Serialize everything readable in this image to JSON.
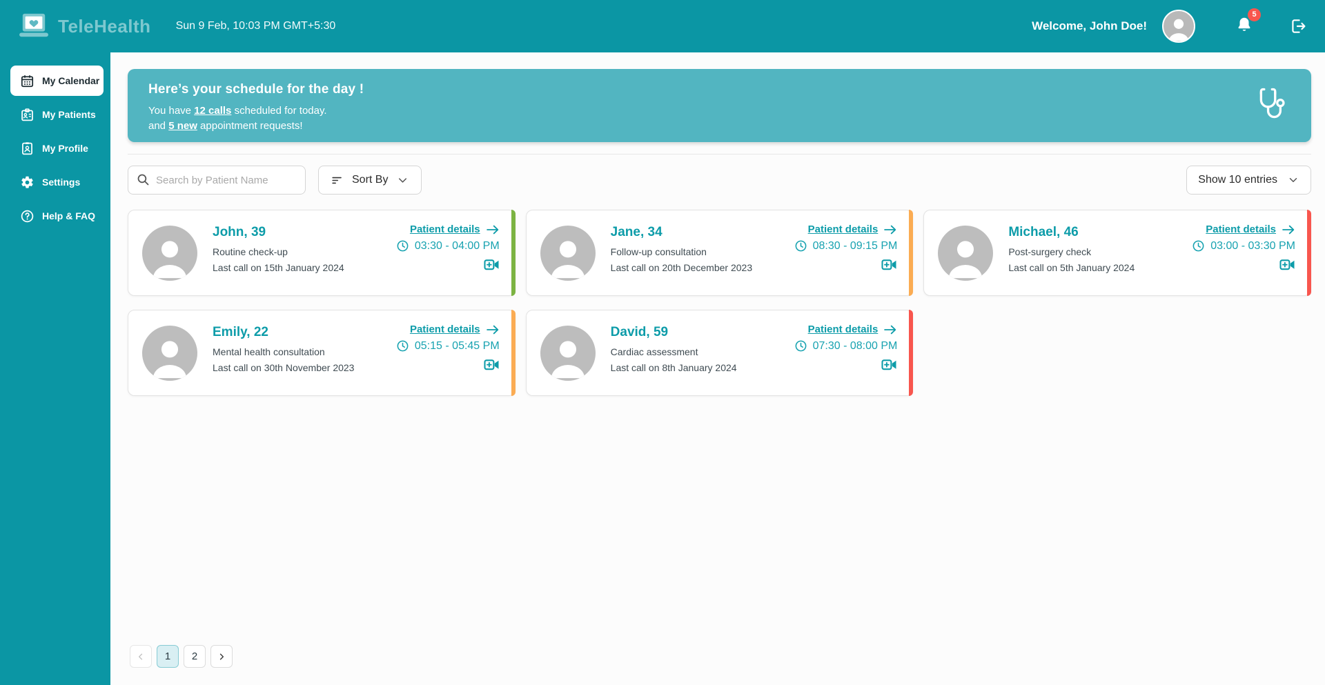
{
  "header": {
    "brand": "TeleHealth",
    "datetime": "Sun 9 Feb, 10:03 PM GMT+5:30",
    "welcome": "Welcome, John Doe!",
    "notification_count": "5"
  },
  "sidebar": {
    "items": [
      {
        "label": "My Calendar",
        "icon": "calendar-icon",
        "active": true
      },
      {
        "label": "My Patients",
        "icon": "patients-icon",
        "active": false
      },
      {
        "label": "My Profile",
        "icon": "profile-icon",
        "active": false
      },
      {
        "label": "Settings",
        "icon": "settings-icon",
        "active": false
      },
      {
        "label": "Help & FAQ",
        "icon": "help-icon",
        "active": false
      }
    ]
  },
  "banner": {
    "title": "Here’s your schedule for the day !",
    "line1_prefix": "You have ",
    "line1_bold": "12 calls",
    "line1_suffix": " scheduled for today.",
    "line2_prefix": "and ",
    "line2_bold": "5 new",
    "line2_suffix": " appointment requests!",
    "icon": "stethoscope-icon"
  },
  "toolbar": {
    "search_placeholder": "Search by Patient Name",
    "sort_label": "Sort By",
    "entries_label": "Show 10 entries"
  },
  "cards": [
    {
      "name": "John, 39",
      "type": "Routine check-up",
      "last_call": "Last call on 15th January 2024",
      "details_label": "Patient details",
      "time": "03:30 - 04:00 PM",
      "stripe_color": "#7CB342"
    },
    {
      "name": "Jane, 34",
      "type": "Follow-up consultation",
      "last_call": "Last call on 20th December 2023",
      "details_label": "Patient details",
      "time": "08:30 - 09:15 PM",
      "stripe_color": "#FBAC53"
    },
    {
      "name": "Michael, 46",
      "type": "Post-surgery check",
      "last_call": "Last call on 5th January 2024",
      "details_label": "Patient details",
      "time": "03:00 - 03:30 PM",
      "stripe_color": "#F8564E"
    },
    {
      "name": "Emily, 22",
      "type": "Mental health consultation",
      "last_call": "Last call on 30th November 2023",
      "details_label": "Patient details",
      "time": "05:15 - 05:45 PM",
      "stripe_color": "#FBAC53"
    },
    {
      "name": "David, 59",
      "type": "Cardiac assessment",
      "last_call": "Last call on 8th January 2024",
      "details_label": "Patient details",
      "time": "07:30 - 08:00 PM",
      "stripe_color": "#F8564E"
    }
  ],
  "pagination": {
    "page1": "1",
    "page2": "2",
    "active_page": "1"
  },
  "icons": [
    "telehealth-logo-icon",
    "calendar-icon",
    "patients-icon",
    "profile-icon",
    "settings-icon",
    "help-icon",
    "bell-icon",
    "logout-icon",
    "search-icon",
    "sort-icon",
    "chevron-down-icon",
    "clock-icon",
    "video-call-icon",
    "arrow-right-icon",
    "person-icon",
    "stethoscope-icon",
    "chevron-left-icon",
    "chevron-right-icon"
  ],
  "colors": {
    "primary_teal": "#0B96A4",
    "banner_teal": "#52B5C1",
    "link_teal": "#0D9CA9",
    "stripe_green": "#7CB342",
    "stripe_orange": "#FBAC53",
    "stripe_red": "#F8564E",
    "badge_red": "#F8564E"
  }
}
